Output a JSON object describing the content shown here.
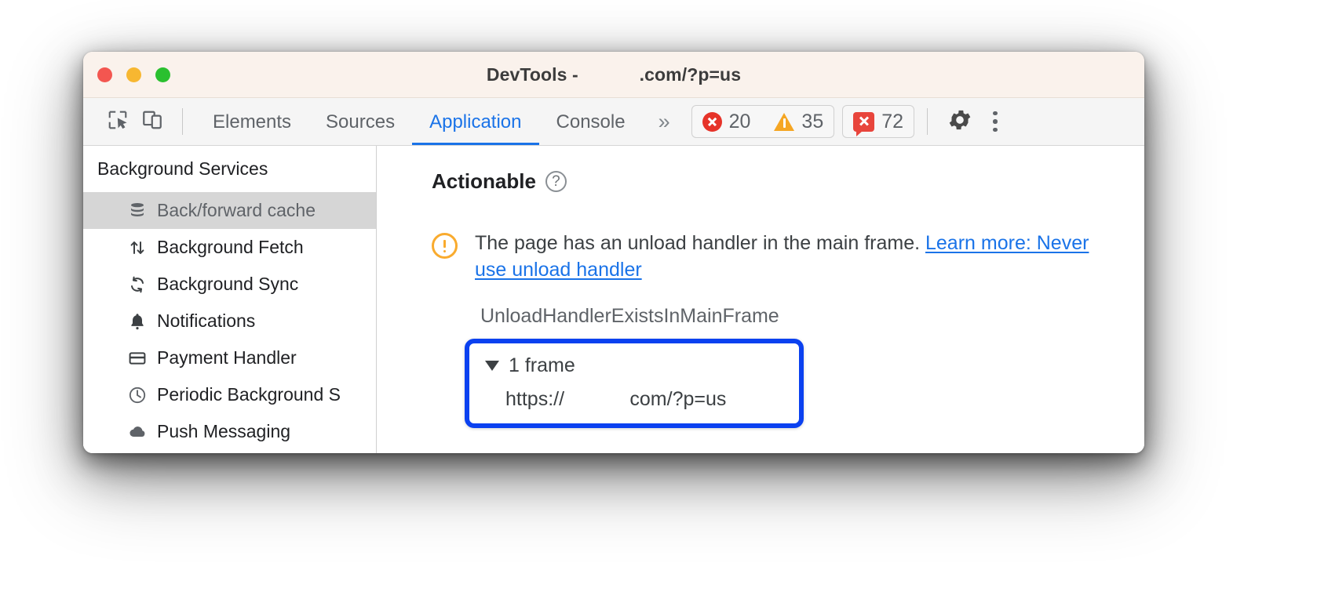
{
  "window": {
    "title_prefix": "DevTools -",
    "title_redacted_gap": "            ",
    "title_suffix": ".com/?p=us",
    "traffic_lights": {
      "close_color": "#f35650",
      "minimize_color": "#f7b731",
      "maximize_color": "#2ac02f"
    }
  },
  "toolbar": {
    "inspect_icon": "inspect-element-icon",
    "device_icon": "device-toolbar-icon",
    "tabs": [
      {
        "label": "Elements",
        "active": false
      },
      {
        "label": "Sources",
        "active": false
      },
      {
        "label": "Application",
        "active": true
      },
      {
        "label": "Console",
        "active": false
      }
    ],
    "more_tabs_label": "»",
    "errors_count": "20",
    "warnings_count": "35",
    "issues_count": "72",
    "settings_icon": "gear-icon",
    "more_options_icon": "kebab-menu-icon",
    "accent_color": "#1a73e8",
    "error_color": "#e63329",
    "warning_color": "#f5a623",
    "issue_color": "#e8453c"
  },
  "sidebar": {
    "header": "Background Services",
    "items": [
      {
        "label": "Back/forward cache",
        "icon": "database-icon",
        "selected": true
      },
      {
        "label": "Background Fetch",
        "icon": "arrows-up-down-icon",
        "selected": false
      },
      {
        "label": "Background Sync",
        "icon": "sync-refresh-icon",
        "selected": false
      },
      {
        "label": "Notifications",
        "icon": "bell-icon",
        "selected": false
      },
      {
        "label": "Payment Handler",
        "icon": "credit-card-icon",
        "selected": false
      },
      {
        "label": "Periodic Background S",
        "icon": "clock-icon",
        "selected": false
      },
      {
        "label": "Push Messaging",
        "icon": "cloud-icon",
        "selected": false
      }
    ],
    "selected_background": "#d6d6d6"
  },
  "main": {
    "section_title": "Actionable",
    "help_icon": "help-question-icon",
    "issue": {
      "icon": "warning-exclamation-circle-icon",
      "text": "The page has an unload handler in the main frame. ",
      "link_text": "Learn more: Never use unload handler",
      "link_color": "#1a73e8",
      "warning_color": "#f9ab2e"
    },
    "reason_code": "UnloadHandlerExistsInMainFrame",
    "frames_box": {
      "highlight_color": "#0b41f0",
      "toggle_icon": "triangle-down-icon",
      "toggle_label": "1 frame",
      "url_prefix": "https://",
      "url_redacted_gap": "            ",
      "url_suffix": "com/?p=us"
    }
  }
}
